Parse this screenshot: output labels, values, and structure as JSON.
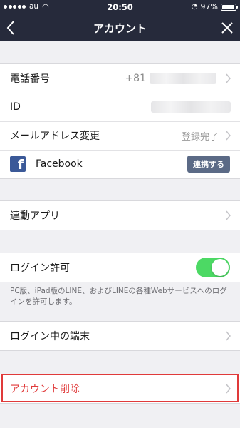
{
  "status_bar": {
    "carrier": "au",
    "time": "20:50",
    "battery": "97%",
    "battery_level": 0.97
  },
  "nav": {
    "title": "アカウント"
  },
  "account": {
    "phone_label": "電話番号",
    "phone_prefix": "+81",
    "id_label": "ID",
    "email_label": "メールアドレス変更",
    "email_status": "登録完了",
    "facebook_label": "Facebook",
    "facebook_button": "連携する"
  },
  "apps": {
    "label": "連動アプリ"
  },
  "login_permission": {
    "label": "ログイン許可",
    "enabled": true,
    "note": "PC版、iPad版のLINE、およびLINEの各種Webサービスへのログインを許可します。"
  },
  "devices": {
    "label": "ログイン中の端末"
  },
  "delete_account": {
    "label": "アカウント削除"
  },
  "colors": {
    "nav_bg": "#262a3b",
    "toggle_on": "#4cd964",
    "facebook": "#3b5998",
    "danger": "#e03a3a"
  }
}
